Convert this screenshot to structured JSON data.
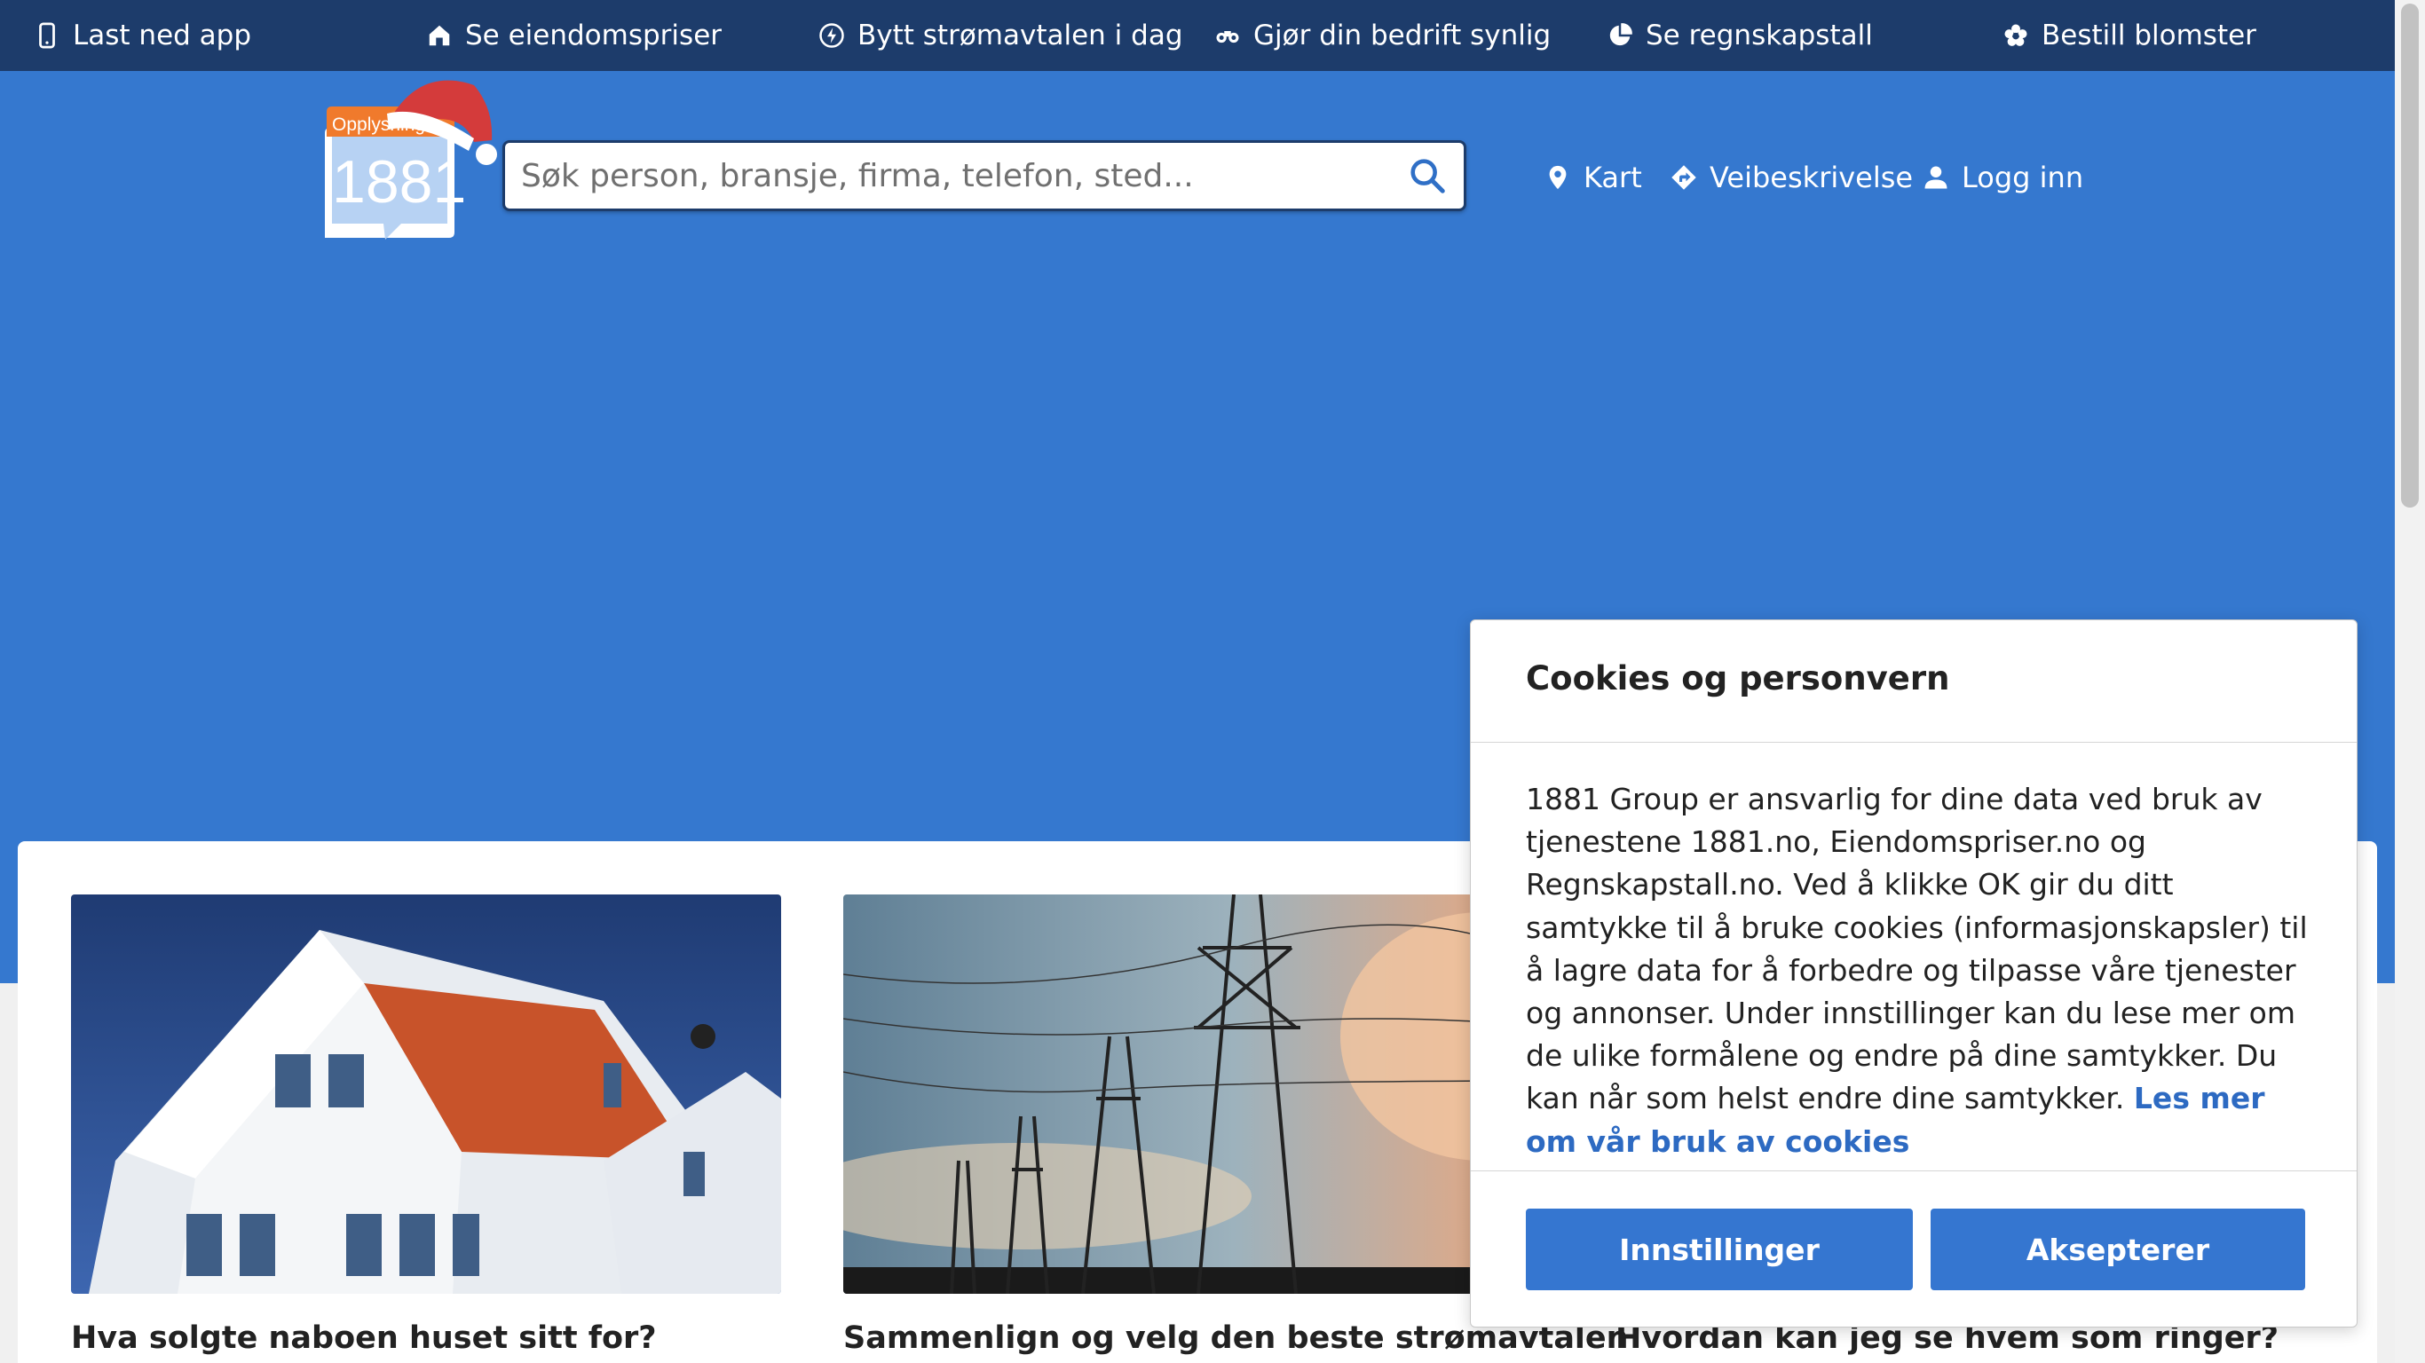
{
  "topbar": {
    "items": [
      {
        "label": "Last ned app",
        "icon": "phone-icon"
      },
      {
        "label": "Se eiendomspriser",
        "icon": "house-icon"
      },
      {
        "label": "Bytt strømavtalen i dag",
        "icon": "lightning-icon"
      },
      {
        "label": "Gjør din bedrift synlig",
        "icon": "binoculars-icon"
      },
      {
        "label": "Se regnskapstall",
        "icon": "pie-chart-icon"
      },
      {
        "label": "Bestill blomster",
        "icon": "flower-icon"
      }
    ]
  },
  "logo": {
    "badge": "Opplysning",
    "number": "1881"
  },
  "search": {
    "placeholder": "Søk person, bransje, firma, telefon, sted..."
  },
  "header_nav": [
    {
      "label": "Kart",
      "icon": "map-pin-icon"
    },
    {
      "label": "Veibeskrivelse",
      "icon": "directions-icon"
    },
    {
      "label": "Logg inn",
      "icon": "user-icon"
    }
  ],
  "cards": [
    {
      "title": "Hva solgte naboen huset sitt for?",
      "image": "white-house-photo"
    },
    {
      "title": "Sammenlign og velg den beste strømavtalen",
      "image": "power-lines-photo"
    },
    {
      "title": "Hvordan kan jeg se hvem som ringer?",
      "image": ""
    }
  ],
  "cookie_dialog": {
    "title": "Cookies og personvern",
    "body": "1881 Group er ansvarlig for dine data ved bruk av tjenestene 1881.no, Eiendomspriser.no og Regnskapstall.no. Ved å klikke OK gir du ditt samtykke til å bruke cookies (informasjonskapsler) til å lagre data for å forbedre og tilpasse våre tjenester og annonser. Under innstillinger kan du lese mer om de ulike formålene og endre på dine samtykker. Du kan når som helst endre dine samtykker.",
    "link_label": "Les mer om vår bruk av cookies",
    "settings_label": "Innstillinger",
    "accept_label": "Aksepterer"
  },
  "colors": {
    "topbar": "#1d3c6b",
    "hero": "#3578cf",
    "button": "#3576d0",
    "link": "#2d6ac2"
  }
}
